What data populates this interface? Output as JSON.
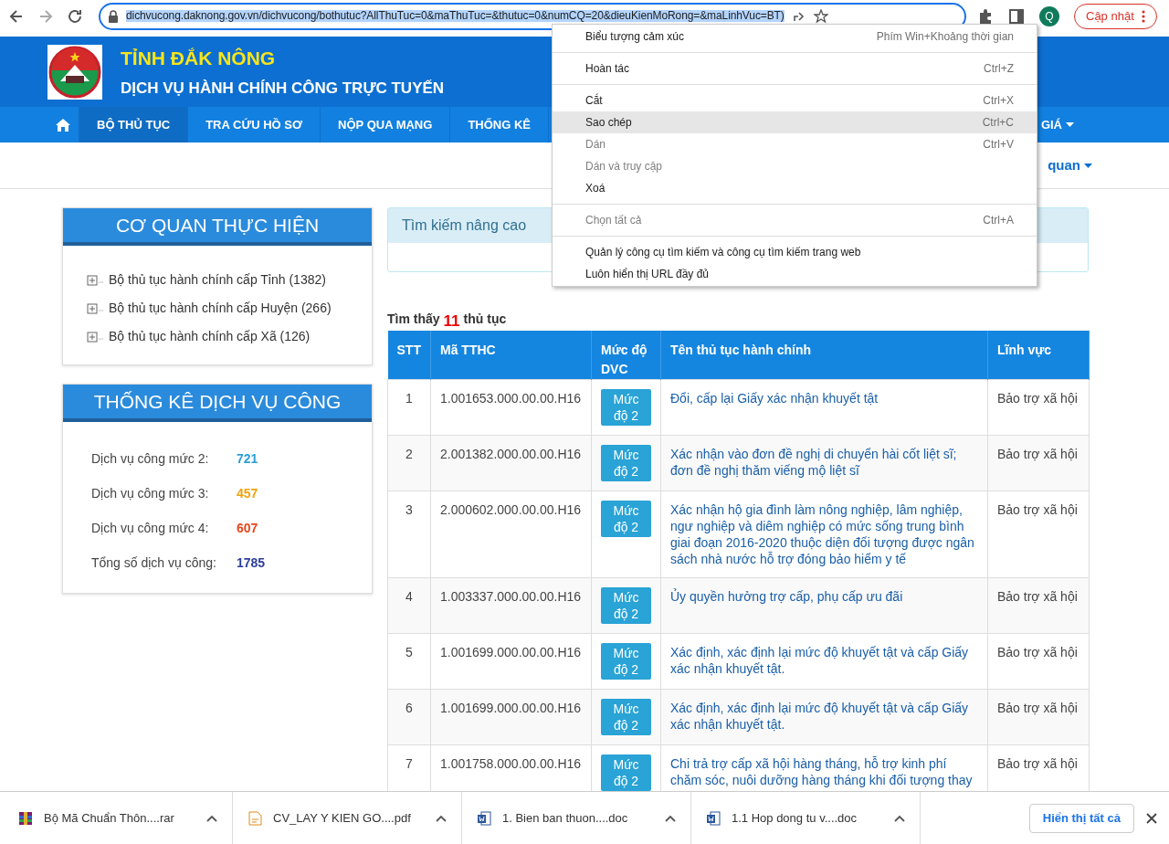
{
  "browser": {
    "url": "dichvucong.daknong.gov.vn/dichvucong/bothutuc?AllThuTuc=0&maThuTuc=&thutuc=0&numCQ=20&dieuKienMoRong=&maLinhVuc=BT)",
    "profile_initial": "Q",
    "update_button": "Cập nhật"
  },
  "header": {
    "title": "TỈNH ĐẮK NÔNG",
    "subtitle": "DỊCH VỤ HÀNH CHÍNH CÔNG TRỰC TUYẾN"
  },
  "nav": [
    {
      "kind": "home",
      "selected": false
    },
    {
      "kind": "text",
      "label": "BỘ THỦ TỤC",
      "selected": true
    },
    {
      "kind": "text",
      "label": "TRA CỨU HỒ SƠ",
      "selected": false
    },
    {
      "kind": "text",
      "label": "NỘP QUA MẠNG",
      "selected": false
    },
    {
      "kind": "text",
      "label": "THỐNG KÊ",
      "selected": false
    },
    {
      "kind": "dropdown",
      "label": "GIÁ",
      "selected": false
    }
  ],
  "subbar_link": "quan",
  "agency_panel": {
    "title": "CƠ QUAN THỰC HIỆN",
    "items": [
      {
        "label": "Bộ thủ tục hành chính cấp Tỉnh (1382)",
        "expanded": false
      },
      {
        "label": "Bộ thủ tục hành chính cấp Huyện (266)",
        "expanded": false
      },
      {
        "label": "Bộ thủ tục hành chính cấp Xã (126)",
        "expanded": false
      }
    ]
  },
  "stats_panel": {
    "title": "THỐNG KÊ DỊCH VỤ CÔNG",
    "rows": [
      {
        "label": "Dịch vụ công mức 2:",
        "value": "721",
        "color": "#2a9fd6"
      },
      {
        "label": "Dịch vụ công mức 3:",
        "value": "457",
        "color": "#f0a30a"
      },
      {
        "label": "Dịch vụ công mức 4:",
        "value": "607",
        "color": "#e8461e"
      },
      {
        "label": "Tổng số dịch vụ công:",
        "value": "1785",
        "color": "#2d3e9c"
      }
    ]
  },
  "search_panel": {
    "title": "Tìm kiếm nâng cao"
  },
  "result": {
    "before": "Tìm thấy",
    "count": "11",
    "after": "thủ tục"
  },
  "table": {
    "columns": [
      "STT",
      "Mã TTHC",
      "Mức độ DVC",
      "Tên thủ tục hành chính",
      "Lĩnh vực"
    ],
    "rows": [
      {
        "stt": "1",
        "code": "1.001653.000.00.00.H16",
        "level": "Mức độ 2",
        "name": "Đổi, cấp lại Giấy xác nhận khuyết tật",
        "field": "Bảo trợ xã hội"
      },
      {
        "stt": "2",
        "code": "2.001382.000.00.00.H16",
        "level": "Mức độ 2",
        "name": "Xác nhận vào đơn đề nghị di chuyển hài cốt liệt sĩ; đơn đề nghị thăm viếng mộ liệt sĩ",
        "field": "Bảo trợ xã hội"
      },
      {
        "stt": "3",
        "code": "2.000602.000.00.00.H16",
        "level": "Mức độ 2",
        "name": "Xác nhận hộ gia đình làm nông nghiệp, lâm nghiệp, ngư nghiệp và diêm nghiệp có mức sống trung bình giai đoạn 2016-2020 thuộc diện đối tượng được ngân sách nhà nước hỗ trợ đóng bảo hiểm y tế",
        "field": "Bảo trợ xã hội"
      },
      {
        "stt": "4",
        "code": "1.003337.000.00.00.H16",
        "level": "Mức độ 2",
        "name": "Ủy quyền hưởng trợ cấp, phụ cấp ưu đãi",
        "field": "Bảo trợ xã hội"
      },
      {
        "stt": "5",
        "code": "1.001699.000.00.00.H16",
        "level": "Mức độ 2",
        "name": "Xác định, xác định lại mức độ khuyết tật và cấp Giấy xác nhận khuyết tật.",
        "field": "Bảo trợ xã hội"
      },
      {
        "stt": "6",
        "code": "1.001699.000.00.00.H16",
        "level": "Mức độ 2",
        "name": "Xác định, xác định lại mức độ khuyết tật và cấp Giấy xác nhận khuyết tật.",
        "field": "Bảo trợ xã hội"
      },
      {
        "stt": "7",
        "code": "1.001758.000.00.00.H16",
        "level": "Mức độ 2",
        "name": "Chi trả trợ cấp xã hội hàng tháng, hỗ trợ kinh phí chăm sóc, nuôi dưỡng hàng tháng khi đối tượng thay",
        "field": "Bảo trợ xã hội"
      }
    ]
  },
  "context_menu": [
    {
      "kind": "item",
      "label": "Biểu tượng cảm xúc",
      "shortcut": "Phím Win+Khoảng thời gian",
      "disabled": false,
      "selected": false
    },
    {
      "kind": "separator"
    },
    {
      "kind": "item",
      "label": "Hoàn tác",
      "shortcut": "Ctrl+Z",
      "disabled": false,
      "selected": false
    },
    {
      "kind": "separator"
    },
    {
      "kind": "item",
      "label": "Cắt",
      "shortcut": "Ctrl+X",
      "disabled": false,
      "selected": false
    },
    {
      "kind": "item",
      "label": "Sao chép",
      "shortcut": "Ctrl+C",
      "disabled": false,
      "selected": true
    },
    {
      "kind": "item",
      "label": "Dán",
      "shortcut": "Ctrl+V",
      "disabled": true,
      "selected": false
    },
    {
      "kind": "item",
      "label": "Dán và truy cập",
      "disabled": true,
      "selected": false
    },
    {
      "kind": "item",
      "label": "Xoá",
      "disabled": false,
      "selected": false
    },
    {
      "kind": "separator"
    },
    {
      "kind": "item",
      "label": "Chọn tất cả",
      "shortcut": "Ctrl+A",
      "disabled": true,
      "selected": false
    },
    {
      "kind": "separator"
    },
    {
      "kind": "item",
      "label": "Quản lý công cụ tìm kiếm và công cụ tìm kiếm trang web",
      "disabled": false,
      "selected": false
    },
    {
      "kind": "item",
      "label": "Luôn hiển thị URL đầy đủ",
      "disabled": false,
      "selected": false
    }
  ],
  "downloads": {
    "items": [
      {
        "kind": "rar",
        "name": "Bộ Mã Chuẩn Thôn....rar"
      },
      {
        "kind": "pdf",
        "name": "CV_LAY Y KIEN GO....pdf"
      },
      {
        "kind": "doc",
        "name": "1. Bien ban thuon....doc"
      },
      {
        "kind": "doc",
        "name": "1.1 Hop dong tu v....doc"
      }
    ],
    "show_all": "Hiển thị tất cả"
  }
}
